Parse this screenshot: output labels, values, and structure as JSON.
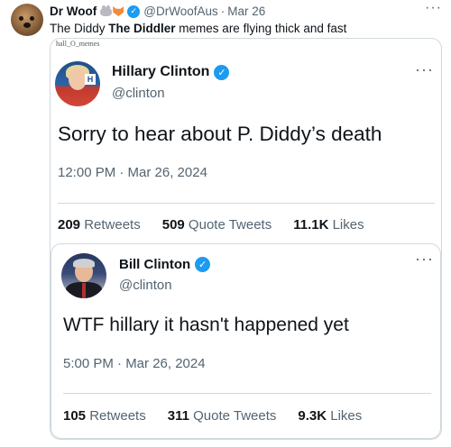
{
  "outer_tweet": {
    "author_name": "Dr Woof",
    "handle": "@DrWoofAus",
    "separator": "·",
    "date": "Mar 26",
    "more_label": "···",
    "text_prefix": "The Diddy ",
    "text_bold": "The Diddler",
    "text_suffix": " memes are flying thick and fast",
    "emoji_icons": [
      "rat-emoji-icon",
      "fox-emoji-icon"
    ],
    "verified_icon": "✓"
  },
  "meme_image": {
    "watermark": "hall_O_memes",
    "hillary_tweet": {
      "name": "Hillary Clinton",
      "handle": "@clinton",
      "more_label": "···",
      "text": "Sorry to hear about P. Diddy’s death",
      "timestamp": "12:00 PM · Mar 26, 2024",
      "stats": [
        {
          "num": "209",
          "label": " Retweets"
        },
        {
          "num": "509",
          "label": " Quote Tweets"
        },
        {
          "num": "11.1K",
          "label": " Likes"
        }
      ]
    },
    "bill_tweet": {
      "name": "Bill Clinton",
      "handle": "@clinton",
      "more_label": "···",
      "text": "WTF hillary it hasn't happened yet",
      "timestamp": "5:00 PM · Mar 26, 2024",
      "stats": [
        {
          "num": "105",
          "label": " Retweets"
        },
        {
          "num": "311",
          "label": " Quote Tweets"
        },
        {
          "num": "9.3K",
          "label": " Likes"
        }
      ]
    }
  },
  "colors": {
    "text_primary": "#0f1419",
    "text_secondary": "#536471",
    "verified_blue": "#1d9bf0",
    "border": "#cfd9de"
  }
}
